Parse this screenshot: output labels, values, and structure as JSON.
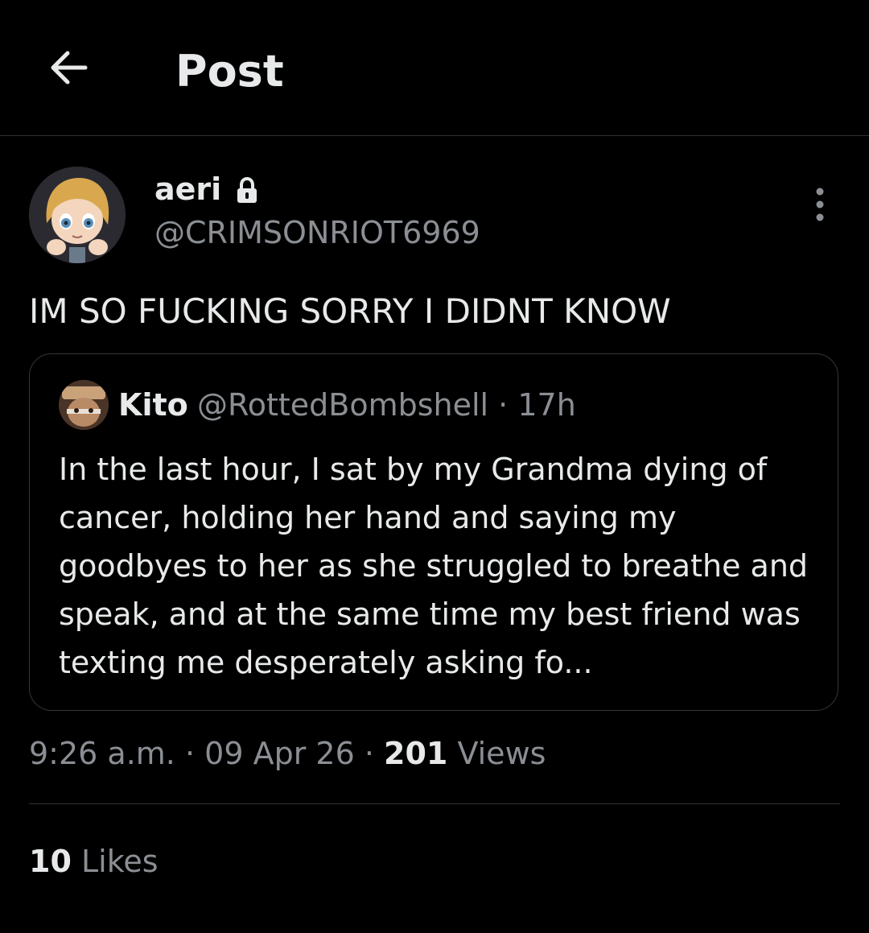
{
  "header": {
    "title": "Post"
  },
  "post": {
    "author": {
      "display_name": "aeri",
      "handle": "@CRIMSONRIOT6969"
    },
    "text": "IM SO FUCKING SORRY I DIDNT KNOW",
    "quoted": {
      "display_name": "Kito",
      "handle": "@RottedBombshell",
      "separator": "·",
      "time_ago": "17h",
      "text": "In the last hour, I sat by my Grandma dying of cancer, holding her hand and saying my goodbyes to her as she struggled to breathe and speak, and at the same time my best friend was texting me desperately asking fo..."
    },
    "meta": {
      "time": "9:26 a.m.",
      "sep1": "·",
      "date": "09 Apr 26",
      "sep2": "·",
      "views_count": "201",
      "views_label": "Views"
    },
    "engagement": {
      "likes_count": "10",
      "likes_label": "Likes"
    }
  },
  "icons": {
    "back": "arrow-left-icon",
    "lock": "lock-icon",
    "more": "more-vertical-icon"
  },
  "colors": {
    "background": "#000000",
    "text_primary": "#e7e9ea",
    "text_secondary": "#8b8f94",
    "border": "#2f3336"
  }
}
